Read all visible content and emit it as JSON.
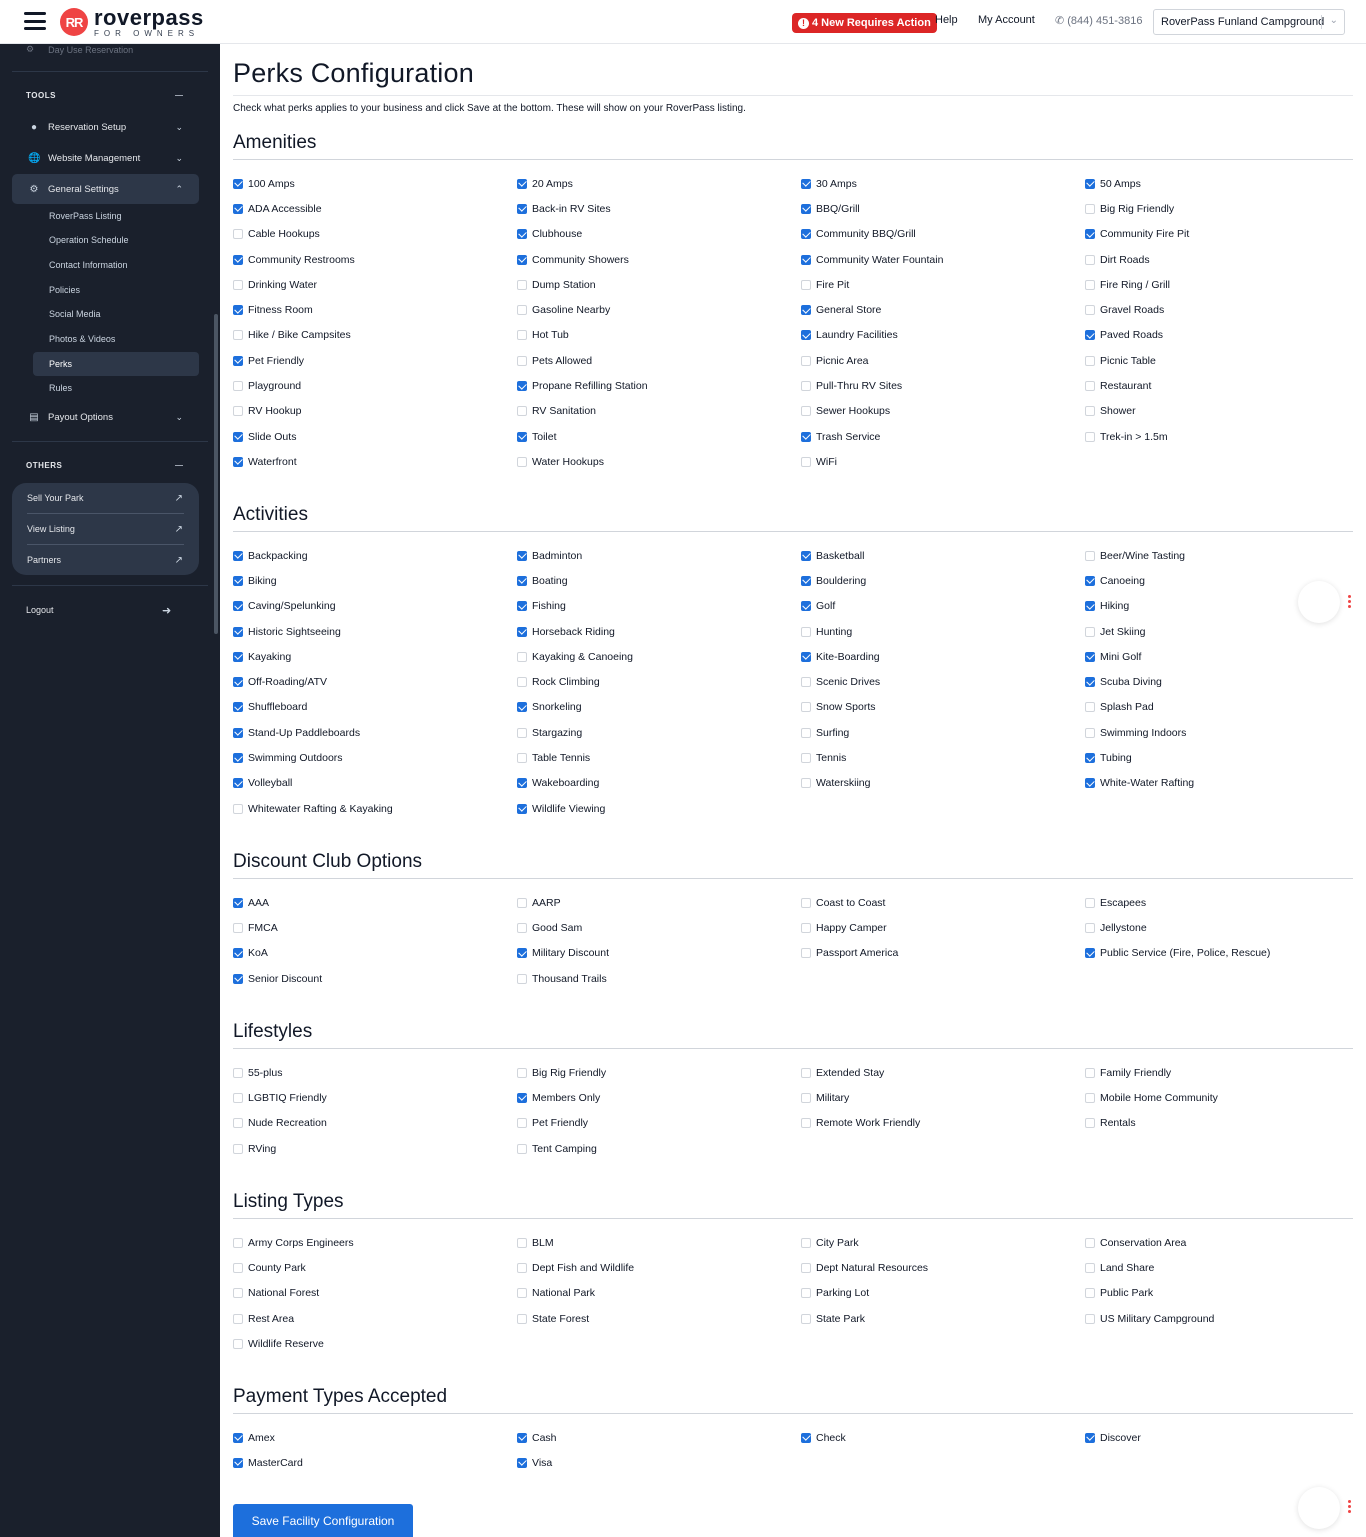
{
  "header": {
    "logo_mark": "RR",
    "logo_name": "roverpass",
    "logo_sub": "FOR OWNERS",
    "alert": "4 New Requires Action",
    "help": "Help",
    "account": "My Account",
    "phone": "(844) 451-3816",
    "campground": "RoverPass Funland Campground"
  },
  "sidebar": {
    "cut_item": "Day Use Reservation",
    "tools_title": "TOOLS",
    "reservation_setup": "Reservation Setup",
    "website_management": "Website Management",
    "general_settings": "General Settings",
    "sub_items": [
      "RoverPass Listing",
      "Operation Schedule",
      "Contact Information",
      "Policies",
      "Social Media",
      "Photos & Videos",
      "Perks",
      "Rules"
    ],
    "payout_options": "Payout Options",
    "others_title": "OTHERS",
    "others_items": [
      "Sell Your Park",
      "View Listing",
      "Partners"
    ],
    "logout": "Logout"
  },
  "main": {
    "title": "Perks Configuration",
    "intro": "Check what perks applies to your business and click Save at the bottom. These will show on your RoverPass listing.",
    "save_label": "Save Facility Configuration"
  },
  "sections": [
    {
      "title": "Amenities",
      "items": [
        {
          "label": "100 Amps",
          "checked": true
        },
        {
          "label": "20 Amps",
          "checked": true
        },
        {
          "label": "30 Amps",
          "checked": true
        },
        {
          "label": "50 Amps",
          "checked": true
        },
        {
          "label": "ADA Accessible",
          "checked": true
        },
        {
          "label": "Back-in RV Sites",
          "checked": true
        },
        {
          "label": "BBQ/Grill",
          "checked": true
        },
        {
          "label": "Big Rig Friendly",
          "checked": false
        },
        {
          "label": "Cable Hookups",
          "checked": false
        },
        {
          "label": "Clubhouse",
          "checked": true
        },
        {
          "label": "Community BBQ/Grill",
          "checked": true
        },
        {
          "label": "Community Fire Pit",
          "checked": true
        },
        {
          "label": "Community Restrooms",
          "checked": true
        },
        {
          "label": "Community Showers",
          "checked": true
        },
        {
          "label": "Community Water Fountain",
          "checked": true
        },
        {
          "label": "Dirt Roads",
          "checked": false
        },
        {
          "label": "Drinking Water",
          "checked": false
        },
        {
          "label": "Dump Station",
          "checked": false
        },
        {
          "label": "Fire Pit",
          "checked": false
        },
        {
          "label": "Fire Ring / Grill",
          "checked": false
        },
        {
          "label": "Fitness Room",
          "checked": true
        },
        {
          "label": "Gasoline Nearby",
          "checked": false
        },
        {
          "label": "General Store",
          "checked": true
        },
        {
          "label": "Gravel Roads",
          "checked": false
        },
        {
          "label": "Hike / Bike Campsites",
          "checked": false
        },
        {
          "label": "Hot Tub",
          "checked": false
        },
        {
          "label": "Laundry Facilities",
          "checked": true
        },
        {
          "label": "Paved Roads",
          "checked": true
        },
        {
          "label": "Pet Friendly",
          "checked": true
        },
        {
          "label": "Pets Allowed",
          "checked": false
        },
        {
          "label": "Picnic Area",
          "checked": false
        },
        {
          "label": "Picnic Table",
          "checked": false
        },
        {
          "label": "Playground",
          "checked": false
        },
        {
          "label": "Propane Refilling Station",
          "checked": true
        },
        {
          "label": "Pull-Thru RV Sites",
          "checked": false
        },
        {
          "label": "Restaurant",
          "checked": false
        },
        {
          "label": "RV Hookup",
          "checked": false
        },
        {
          "label": "RV Sanitation",
          "checked": false
        },
        {
          "label": "Sewer Hookups",
          "checked": false
        },
        {
          "label": "Shower",
          "checked": false
        },
        {
          "label": "Slide Outs",
          "checked": true
        },
        {
          "label": "Toilet",
          "checked": true
        },
        {
          "label": "Trash Service",
          "checked": true
        },
        {
          "label": "Trek-in > 1.5m",
          "checked": false
        },
        {
          "label": "Waterfront",
          "checked": true
        },
        {
          "label": "Water Hookups",
          "checked": false
        },
        {
          "label": "WiFi",
          "checked": false
        }
      ]
    },
    {
      "title": "Activities",
      "items": [
        {
          "label": "Backpacking",
          "checked": true
        },
        {
          "label": "Badminton",
          "checked": true
        },
        {
          "label": "Basketball",
          "checked": true
        },
        {
          "label": "Beer/Wine Tasting",
          "checked": false
        },
        {
          "label": "Biking",
          "checked": true
        },
        {
          "label": "Boating",
          "checked": true
        },
        {
          "label": "Bouldering",
          "checked": true
        },
        {
          "label": "Canoeing",
          "checked": true
        },
        {
          "label": "Caving/Spelunking",
          "checked": true
        },
        {
          "label": "Fishing",
          "checked": true
        },
        {
          "label": "Golf",
          "checked": true
        },
        {
          "label": "Hiking",
          "checked": true
        },
        {
          "label": "Historic Sightseeing",
          "checked": true
        },
        {
          "label": "Horseback Riding",
          "checked": true
        },
        {
          "label": "Hunting",
          "checked": false
        },
        {
          "label": "Jet Skiing",
          "checked": false
        },
        {
          "label": "Kayaking",
          "checked": true
        },
        {
          "label": "Kayaking & Canoeing",
          "checked": false
        },
        {
          "label": "Kite-Boarding",
          "checked": true
        },
        {
          "label": "Mini Golf",
          "checked": true
        },
        {
          "label": "Off-Roading/ATV",
          "checked": true
        },
        {
          "label": "Rock Climbing",
          "checked": false
        },
        {
          "label": "Scenic Drives",
          "checked": false
        },
        {
          "label": "Scuba Diving",
          "checked": true
        },
        {
          "label": "Shuffleboard",
          "checked": true
        },
        {
          "label": "Snorkeling",
          "checked": true
        },
        {
          "label": "Snow Sports",
          "checked": false
        },
        {
          "label": "Splash Pad",
          "checked": false
        },
        {
          "label": "Stand-Up Paddleboards",
          "checked": true
        },
        {
          "label": "Stargazing",
          "checked": false
        },
        {
          "label": "Surfing",
          "checked": false
        },
        {
          "label": "Swimming Indoors",
          "checked": false
        },
        {
          "label": "Swimming Outdoors",
          "checked": true
        },
        {
          "label": "Table Tennis",
          "checked": false
        },
        {
          "label": "Tennis",
          "checked": false
        },
        {
          "label": "Tubing",
          "checked": true
        },
        {
          "label": "Volleyball",
          "checked": true
        },
        {
          "label": "Wakeboarding",
          "checked": true
        },
        {
          "label": "Waterskiing",
          "checked": false
        },
        {
          "label": "White-Water Rafting",
          "checked": true
        },
        {
          "label": "Whitewater Rafting & Kayaking",
          "checked": false
        },
        {
          "label": "Wildlife Viewing",
          "checked": true
        }
      ]
    },
    {
      "title": "Discount Club Options",
      "items": [
        {
          "label": "AAA",
          "checked": true
        },
        {
          "label": "AARP",
          "checked": false
        },
        {
          "label": "Coast to Coast",
          "checked": false
        },
        {
          "label": "Escapees",
          "checked": false
        },
        {
          "label": "FMCA",
          "checked": false
        },
        {
          "label": "Good Sam",
          "checked": false
        },
        {
          "label": "Happy Camper",
          "checked": false
        },
        {
          "label": "Jellystone",
          "checked": false
        },
        {
          "label": "KoA",
          "checked": true
        },
        {
          "label": "Military Discount",
          "checked": true
        },
        {
          "label": "Passport America",
          "checked": false
        },
        {
          "label": "Public Service (Fire, Police, Rescue)",
          "checked": true
        },
        {
          "label": "Senior Discount",
          "checked": true
        },
        {
          "label": "Thousand Trails",
          "checked": false
        }
      ]
    },
    {
      "title": "Lifestyles",
      "items": [
        {
          "label": "55-plus",
          "checked": false
        },
        {
          "label": "Big Rig Friendly",
          "checked": false
        },
        {
          "label": "Extended Stay",
          "checked": false
        },
        {
          "label": "Family Friendly",
          "checked": false
        },
        {
          "label": "LGBTIQ Friendly",
          "checked": false
        },
        {
          "label": "Members Only",
          "checked": true
        },
        {
          "label": "Military",
          "checked": false
        },
        {
          "label": "Mobile Home Community",
          "checked": false
        },
        {
          "label": "Nude Recreation",
          "checked": false
        },
        {
          "label": "Pet Friendly",
          "checked": false
        },
        {
          "label": "Remote Work Friendly",
          "checked": false
        },
        {
          "label": "Rentals",
          "checked": false
        },
        {
          "label": "RVing",
          "checked": false
        },
        {
          "label": "Tent Camping",
          "checked": false
        }
      ]
    },
    {
      "title": "Listing Types",
      "items": [
        {
          "label": "Army Corps Engineers",
          "checked": false
        },
        {
          "label": "BLM",
          "checked": false
        },
        {
          "label": "City Park",
          "checked": false
        },
        {
          "label": "Conservation Area",
          "checked": false
        },
        {
          "label": "County Park",
          "checked": false
        },
        {
          "label": "Dept Fish and Wildlife",
          "checked": false
        },
        {
          "label": "Dept Natural Resources",
          "checked": false
        },
        {
          "label": "Land Share",
          "checked": false
        },
        {
          "label": "National Forest",
          "checked": false
        },
        {
          "label": "National Park",
          "checked": false
        },
        {
          "label": "Parking Lot",
          "checked": false
        },
        {
          "label": "Public Park",
          "checked": false
        },
        {
          "label": "Rest Area",
          "checked": false
        },
        {
          "label": "State Forest",
          "checked": false
        },
        {
          "label": "State Park",
          "checked": false
        },
        {
          "label": "US Military Campground",
          "checked": false
        },
        {
          "label": "Wildlife Reserve",
          "checked": false
        }
      ]
    },
    {
      "title": "Payment Types Accepted",
      "items": [
        {
          "label": "Amex",
          "checked": true
        },
        {
          "label": "Cash",
          "checked": true
        },
        {
          "label": "Check",
          "checked": true
        },
        {
          "label": "Discover",
          "checked": true
        },
        {
          "label": "MasterCard",
          "checked": true
        },
        {
          "label": "Visa",
          "checked": true
        }
      ]
    }
  ],
  "colors": {
    "accent": "#1d6fdc",
    "sidebar_bg": "#1a202c",
    "alert": "#dc2626",
    "brand": "#ef4444"
  }
}
